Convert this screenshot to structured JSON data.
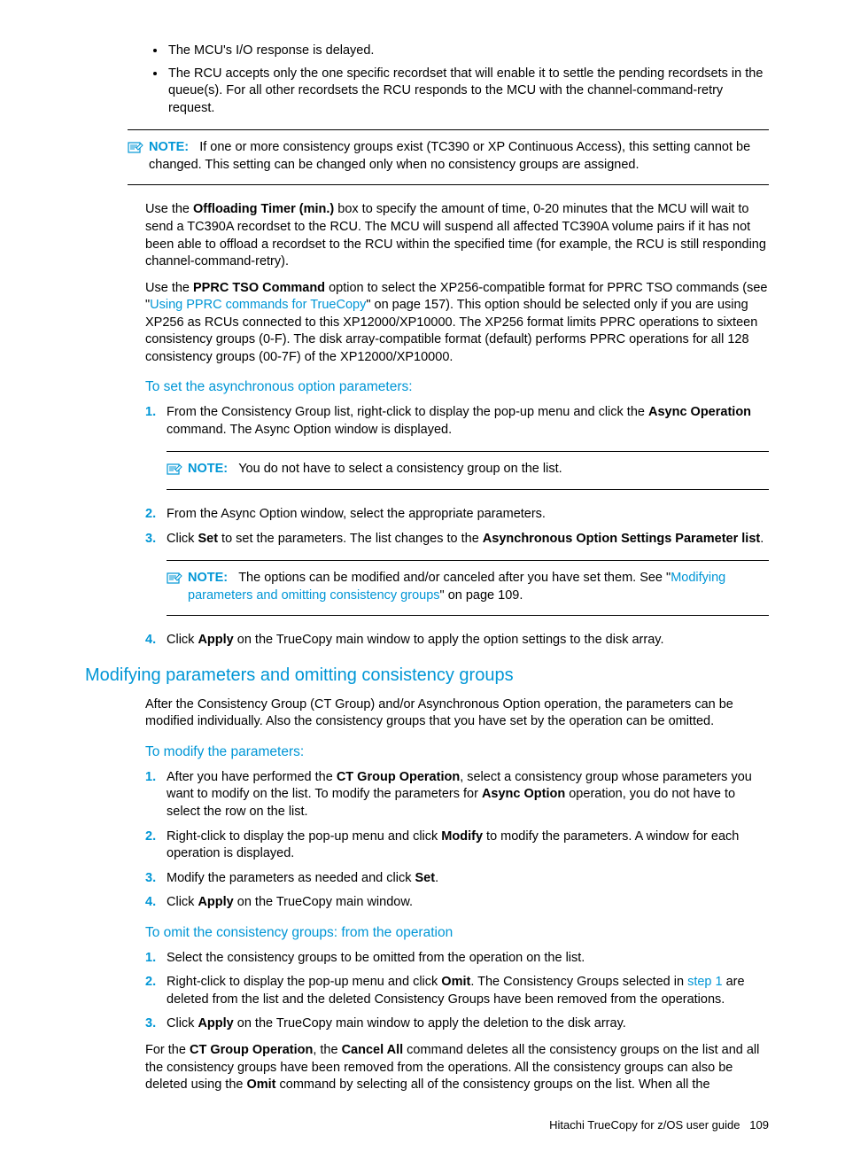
{
  "bullets": {
    "b1": "The MCU's I/O response is delayed.",
    "b2": "The RCU accepts only the one specific recordset that will enable it to settle the pending recordsets in the queue(s). For all other recordsets the RCU responds to the MCU with the channel-command-retry request."
  },
  "note1": {
    "label": "NOTE:",
    "text": "If one or more consistency groups exist (TC390 or XP Continuous Access), this setting cannot be changed. This setting can be changed only when no consistency groups are assigned."
  },
  "para_offload": {
    "pre": "Use the ",
    "b1": "Offloading Timer (min.)",
    "post": " box to specify the amount of time, 0-20 minutes that the MCU will wait to send a TC390A recordset to the RCU. The MCU will suspend all affected TC390A volume pairs if it has not been able to offload a recordset to the RCU within the specified time (for example, the RCU is still responding channel-command-retry)."
  },
  "para_pprc": {
    "pre": "Use the ",
    "b1": "PPRC TSO Command",
    "mid1": " option to select the XP256-compatible format for PPRC TSO commands (see \"",
    "link": "Using PPRC commands for TrueCopy",
    "mid2": "\" on page 157). This option should be selected only if you are using XP256 as RCUs connected to this XP12000/XP10000. The XP256 format limits PPRC operations to sixteen consistency groups (0-F). The disk array-compatible format (default) performs PPRC operations for all 128 consistency groups (00-7F) of the XP12000/XP10000."
  },
  "hd_async": "To set the asynchronous option parameters:",
  "steps_async": {
    "s1": {
      "pre": "From the Consistency Group list, right-click to display the pop-up menu and click the ",
      "b": "Async Operation",
      "post": " command. The Async Option window is displayed."
    },
    "s2": "From the Async Option window, select the appropriate parameters.",
    "s3": {
      "pre": "Click ",
      "b1": "Set",
      "mid": " to set the parameters. The list changes to the ",
      "b2": "Asynchronous Option Settings Parameter list",
      "post": "."
    },
    "s4": {
      "pre": "Click ",
      "b": "Apply",
      "post": " on the TrueCopy main window to apply the option settings to the disk array."
    }
  },
  "note2": {
    "label": "NOTE:",
    "text": "You do not have to select a consistency group on the list."
  },
  "note3": {
    "label": "NOTE:",
    "pre": "The options can be modified and/or canceled after you have set them. See \"",
    "link": "Modifying parameters and omitting consistency groups",
    "post": "\" on page 109."
  },
  "hd_modify_section": "Modifying parameters and omitting consistency groups",
  "para_modify": "After the Consistency Group (CT Group) and/or Asynchronous Option operation, the parameters can be modified individually. Also the consistency groups that you have set by the operation can be omitted.",
  "hd_modify": "To modify the parameters:",
  "steps_modify": {
    "s1": {
      "pre": "After you have performed the ",
      "b1": "CT Group Operation",
      "mid": ", select a consistency group whose parameters you want to modify on the list. To modify the parameters for ",
      "b2": "Async Option",
      "post": " operation, you do not have to select the row on the list."
    },
    "s2": {
      "pre": "Right-click to display the pop-up menu and click ",
      "b": "Modify",
      "post": " to modify the parameters. A window for each operation is displayed."
    },
    "s3": {
      "pre": "Modify the parameters as needed and click ",
      "b": "Set",
      "post": "."
    },
    "s4": {
      "pre": "Click ",
      "b": "Apply",
      "post": " on the TrueCopy main window."
    }
  },
  "hd_omit": "To omit the consistency groups: from the operation",
  "steps_omit": {
    "s1": "Select the consistency groups to be omitted from the operation on the list.",
    "s2": {
      "pre": "Right-click to display the pop-up menu and click ",
      "b": "Omit",
      "mid": ". The Consistency Groups selected in ",
      "link": "step 1",
      "post": " are deleted from the list and the deleted Consistency Groups have been removed from the operations."
    },
    "s3": {
      "pre": "Click ",
      "b": "Apply",
      "post": " on the TrueCopy main window to apply the deletion to the disk array."
    }
  },
  "para_footer": {
    "pre": "For the ",
    "b1": "CT Group Operation",
    "mid1": ", the ",
    "b2": "Cancel All",
    "mid2": " command deletes all the consistency groups on the list and all the consistency groups have been removed from the operations. All the consistency groups can also be deleted using the ",
    "b3": "Omit",
    "post": " command by selecting all of the consistency groups on the list. When all the"
  },
  "footer": {
    "title": "Hitachi TrueCopy for z/OS user guide",
    "page": "109"
  }
}
